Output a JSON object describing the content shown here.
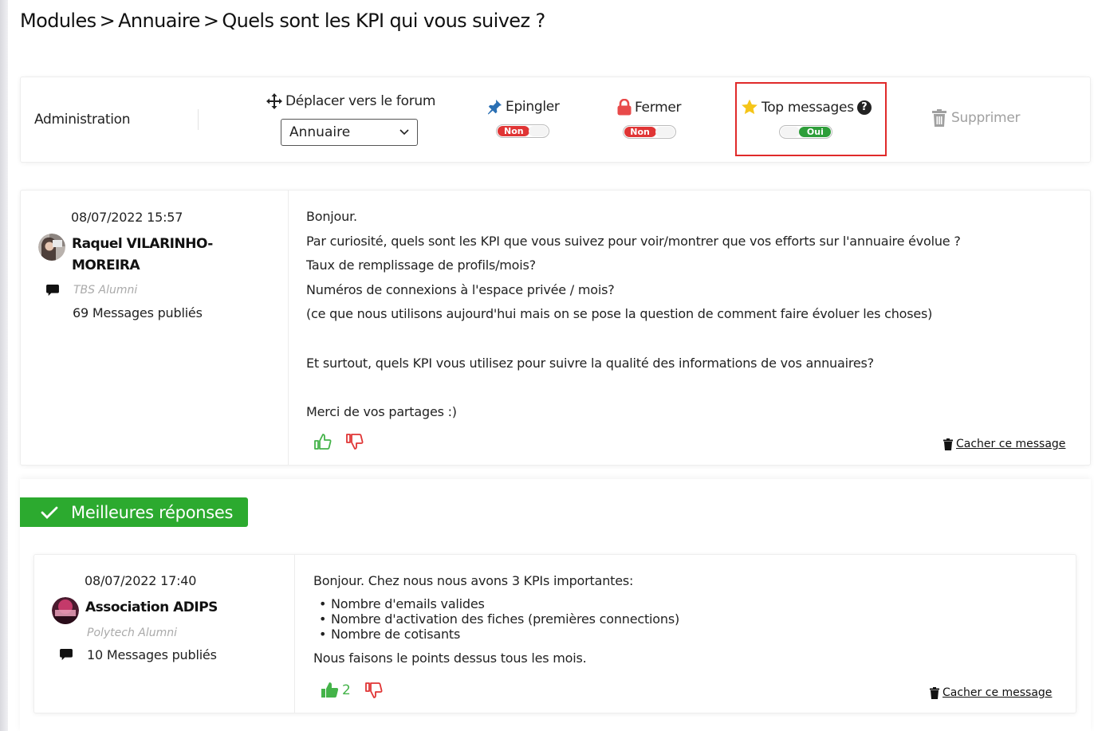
{
  "breadcrumb": {
    "modules": "Modules",
    "annuaire": "Annuaire",
    "topic": "Quels sont les KPI qui vous suivez ?",
    "separator": ">"
  },
  "admin": {
    "title": "Administration",
    "move_label": "Déplacer vers le forum",
    "move_value": "Annuaire",
    "pin_label": "Epingler",
    "pin_state": "Non",
    "close_label": "Fermer",
    "close_state": "Non",
    "top_label": "Top messages",
    "top_state": "Oui",
    "help_glyph": "?",
    "delete_label": "Supprimer"
  },
  "post": {
    "date": "08/07/2022 15:57",
    "author_line1": "Raquel VILARINHO-",
    "author_line2": "MOREIRA",
    "org": "TBS Alumni",
    "messages": "69 Messages publiés",
    "lines": [
      "Bonjour.",
      "Par curiosité, quels sont les KPI que vous suivez pour voir/montrer que vos efforts sur l'annuaire évolue ?",
      "Taux de remplissage de profils/mois?",
      "Numéros de connexions à l'espace privée / mois?",
      "(ce que nous utilisons aujourd'hui mais on se pose la question de comment faire évoluer les choses)",
      "",
      "Et surtout, quels KPI vous utilisez pour suivre la qualité des informations de vos annuaires?",
      "",
      "Merci de vos partages :)"
    ],
    "hide_label": "Cacher ce message"
  },
  "best": {
    "banner": "Meilleures réponses",
    "date": "08/07/2022 17:40",
    "author": "Association ADIPS",
    "org": "Polytech Alumni",
    "messages": "10 Messages publiés",
    "intro": "Bonjour. Chez nous nous avons 3 KPIs importantes:",
    "items": [
      "Nombre d'emails valides",
      "Nombre d'activation des fiches (premières connections)",
      "Nombre de cotisants"
    ],
    "outro": "Nous faisons le points dessus tous les mois.",
    "likes": "2",
    "hide_label": "Cacher ce message"
  },
  "colors": {
    "accent_green": "#2caa2f",
    "toggle_off": "#e03535",
    "toggle_on": "#2e9e3a",
    "highlight": "#e02a2a",
    "pin_blue": "#2a6fb3",
    "lock_red": "#e84a4a",
    "star_yellow": "#f5c518"
  }
}
